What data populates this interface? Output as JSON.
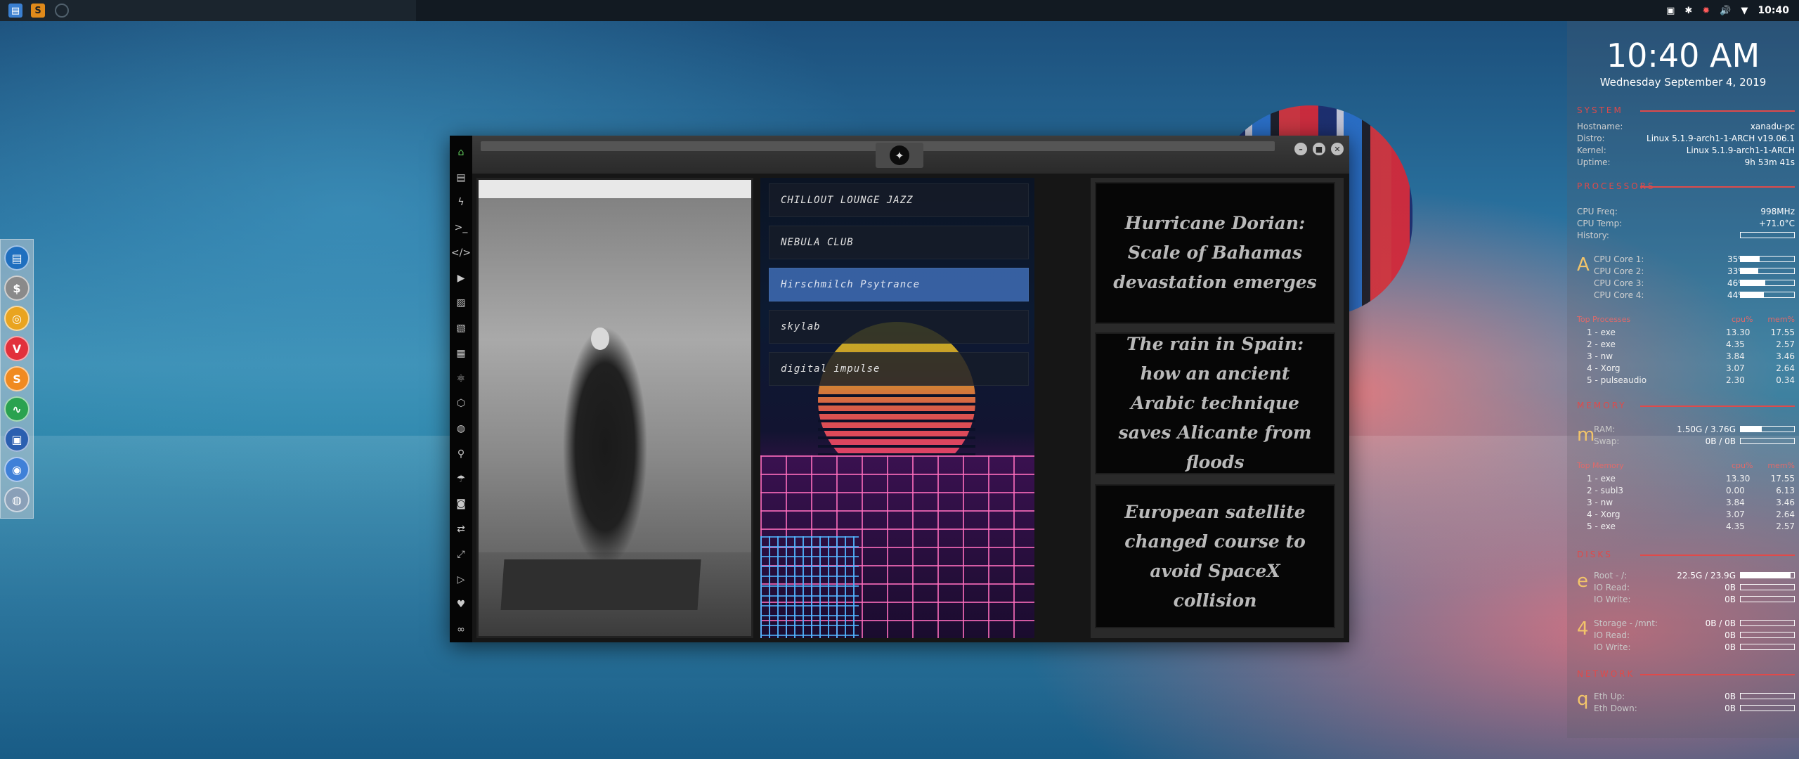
{
  "taskbar": {
    "clock": "10:40",
    "sublime_glyph": "S"
  },
  "dock": {
    "items": [
      {
        "name": "files",
        "color": "#1f6fbf",
        "glyph": "▤"
      },
      {
        "name": "terminal-money",
        "color": "#8a8a8a",
        "glyph": "$"
      },
      {
        "name": "ubuntu-like",
        "color": "#e9a420",
        "glyph": "◎"
      },
      {
        "name": "vivaldi",
        "color": "#e2303b",
        "glyph": "V"
      },
      {
        "name": "sublime",
        "color": "#f08a20",
        "glyph": "S"
      },
      {
        "name": "system-monitor",
        "color": "#2aa24f",
        "glyph": "∿"
      },
      {
        "name": "screenshot",
        "color": "#2b5fb0",
        "glyph": "▣"
      },
      {
        "name": "chromium",
        "color": "#3f80d8",
        "glyph": "◉"
      },
      {
        "name": "network",
        "color": "#8aa0b8",
        "glyph": "◍"
      }
    ]
  },
  "app": {
    "sidebar_icons": [
      "home-icon",
      "document-icon",
      "lightning-icon",
      "terminal-icon",
      "code-icon",
      "play-icon",
      "gallery-icon",
      "image-icon",
      "news-icon",
      "atom-icon",
      "hexagon-icon",
      "globe-icon",
      "search-icon",
      "umbrella-icon",
      "portrait-icon",
      "exchange-icon",
      "expand-icon",
      "youtube-icon",
      "heart-icon",
      "link-icon"
    ],
    "music": {
      "stations": [
        "CHILLOUT LOUNGE JAZZ",
        "NEBULA CLUB",
        "Hirschmilch Psytrance",
        "skylab",
        "digital impulse"
      ],
      "selected_index": 2
    },
    "news": {
      "headlines": [
        "Hurricane Dorian: Scale of Bahamas devastation emerges",
        "The rain in Spain: how an ancient Arabic technique saves Alicante from floods",
        "European satellite changed course to avoid SpaceX collision"
      ]
    }
  },
  "conky": {
    "time": "10:40 AM",
    "date": "Wednesday September  4, 2019",
    "system": {
      "title": "SYSTEM",
      "rows": [
        {
          "k": "Hostname:",
          "v": "xanadu-pc"
        },
        {
          "k": "Distro:",
          "v": "Linux 5.1.9-arch1-1-ARCH v19.06.1"
        },
        {
          "k": "Kernel:",
          "v": "Linux 5.1.9-arch1-1-ARCH"
        },
        {
          "k": "Uptime:",
          "v": "9h 53m 41s"
        }
      ]
    },
    "processors": {
      "title": "PROCESSORS",
      "freq": {
        "k": "CPU Freq:",
        "v": "998MHz"
      },
      "temp": {
        "k": "CPU Temp:",
        "v": "+71.0°C"
      },
      "history_label": "History:",
      "letter": "A",
      "cores": [
        {
          "k": "CPU Core 1:",
          "p": "35%",
          "v": 0.35
        },
        {
          "k": "CPU Core 2:",
          "p": "33%",
          "v": 0.33
        },
        {
          "k": "CPU Core 3:",
          "p": "46%",
          "v": 0.46
        },
        {
          "k": "CPU Core 4:",
          "p": "44%",
          "v": 0.44
        }
      ],
      "top_head": [
        "Top Processes",
        "cpu%",
        "mem%"
      ],
      "top": [
        {
          "n": "1 - exe",
          "a": "13.30",
          "b": "17.55"
        },
        {
          "n": "2 - exe",
          "a": "4.35",
          "b": "2.57"
        },
        {
          "n": "3 - nw",
          "a": "3.84",
          "b": "3.46"
        },
        {
          "n": "4 - Xorg",
          "a": "3.07",
          "b": "2.64"
        },
        {
          "n": "5 - pulseaudio",
          "a": "2.30",
          "b": "0.34"
        }
      ]
    },
    "memory": {
      "title": "MEMORY",
      "letter": "m",
      "rows": [
        {
          "k": "RAM:",
          "v": "1.50G / 3.76G",
          "f": 0.4
        },
        {
          "k": "Swap:",
          "v": "0B / 0B",
          "f": 0
        }
      ],
      "top_head": [
        "Top Memory",
        "cpu%",
        "mem%"
      ],
      "top": [
        {
          "n": "1 - exe",
          "a": "13.30",
          "b": "17.55"
        },
        {
          "n": "2 - subl3",
          "a": "0.00",
          "b": "6.13"
        },
        {
          "n": "3 - nw",
          "a": "3.84",
          "b": "3.46"
        },
        {
          "n": "4 - Xorg",
          "a": "3.07",
          "b": "2.64"
        },
        {
          "n": "5 - exe",
          "a": "4.35",
          "b": "2.57"
        }
      ]
    },
    "disks": {
      "title": "DISKS",
      "letter_root": "e",
      "root_rows": [
        {
          "k": "Root - /:",
          "v": "22.5G / 23.9G",
          "f": 0.94
        },
        {
          "k": "IO Read:",
          "v": "0B",
          "f": 0
        },
        {
          "k": "IO Write:",
          "v": "0B",
          "f": 0
        }
      ],
      "letter_home": "4",
      "home_rows": [
        {
          "k": "Storage - /mnt:",
          "v": "0B / 0B",
          "f": 0
        },
        {
          "k": "IO Read:",
          "v": "0B",
          "f": 0
        },
        {
          "k": "IO Write:",
          "v": "0B",
          "f": 0
        }
      ]
    },
    "network": {
      "title": "NETWORK",
      "letter": "q",
      "rows": [
        {
          "k": "Eth Up:",
          "v": "0B",
          "f": 0
        },
        {
          "k": "Eth Down:",
          "v": "0B",
          "f": 0
        }
      ]
    }
  }
}
